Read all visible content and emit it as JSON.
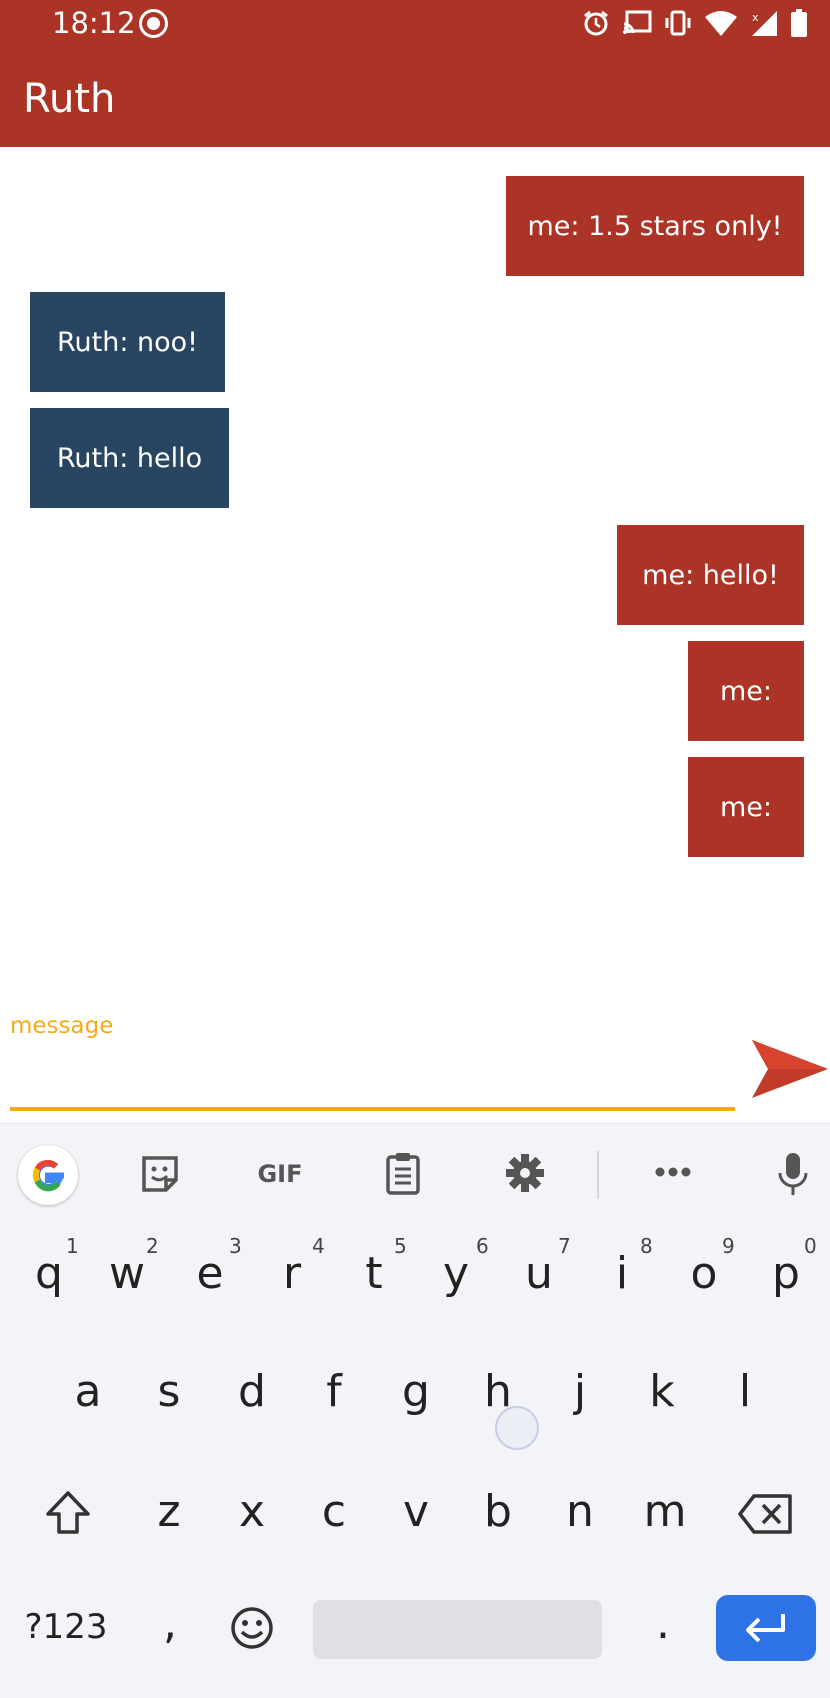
{
  "status_bar": {
    "time": "18:12",
    "icons": [
      "record-icon",
      "alarm-icon",
      "cast-icon",
      "vibrate-icon",
      "wifi-icon",
      "signal-icon",
      "battery-icon"
    ]
  },
  "app_bar": {
    "title": "Ruth"
  },
  "messages": [
    {
      "sender": "me",
      "text": "me: 1.5 stars only!"
    },
    {
      "sender": "them",
      "text": "Ruth: noo!"
    },
    {
      "sender": "them",
      "text": "Ruth: hello"
    },
    {
      "sender": "me",
      "text": "me: hello!"
    },
    {
      "sender": "me",
      "text": "me:"
    },
    {
      "sender": "me",
      "text": "me:"
    }
  ],
  "composer": {
    "label": "message",
    "value": "",
    "send_icon": "send-icon"
  },
  "keyboard": {
    "toolbar": [
      "google-icon",
      "sticker-icon",
      "GIF",
      "clipboard-icon",
      "gear-icon",
      "more-icon",
      "mic-icon"
    ],
    "gif_label": "GIF",
    "row1": [
      "q",
      "w",
      "e",
      "r",
      "t",
      "y",
      "u",
      "i",
      "o",
      "p"
    ],
    "row1_hints": [
      "1",
      "2",
      "3",
      "4",
      "5",
      "6",
      "7",
      "8",
      "9",
      "0"
    ],
    "row2": [
      "a",
      "s",
      "d",
      "f",
      "g",
      "h",
      "j",
      "k",
      "l"
    ],
    "row3": [
      "z",
      "x",
      "c",
      "v",
      "b",
      "n",
      "m"
    ],
    "symbols_label": "?123",
    "comma": ",",
    "period": ".",
    "colors": {
      "accent": "#ab3427",
      "incoming": "#284662",
      "input_accent": "#f2ab1d",
      "enter": "#2d73e5"
    }
  }
}
